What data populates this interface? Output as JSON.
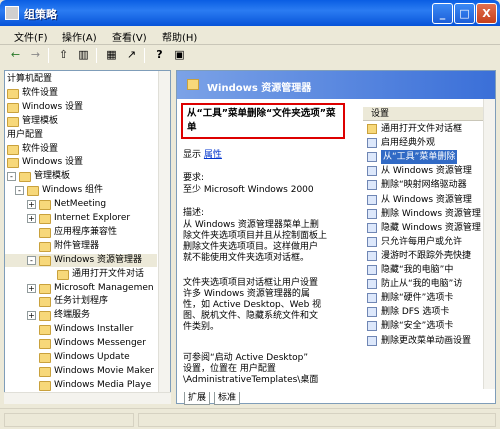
{
  "window": {
    "title": "组策略",
    "min": "_",
    "max": "□",
    "close": "X"
  },
  "menu": [
    "文件(F)",
    "操作(A)",
    "查看(V)",
    "帮助(H)"
  ],
  "toolbar": {
    "back": "←",
    "forward": "→",
    "up": "⇧",
    "showhide": "▥",
    "properties": "▦",
    "export": "↗",
    "help": "?",
    "console": "▣"
  },
  "tree": [
    {
      "label": "计算机配置",
      "level": 0,
      "icon": "none"
    },
    {
      "label": "软件设置",
      "level": 1,
      "icon": "folder"
    },
    {
      "label": "Windows 设置",
      "level": 1,
      "icon": "folder"
    },
    {
      "label": "管理模板",
      "level": 1,
      "icon": "folder"
    },
    {
      "label": "用户配置",
      "level": 0,
      "icon": "none"
    },
    {
      "label": "软件设置",
      "level": 1,
      "icon": "folder"
    },
    {
      "label": "Windows 设置",
      "level": 1,
      "icon": "folder"
    },
    {
      "label": "管理模板",
      "level": 1,
      "icon": "folder",
      "expander": "-"
    },
    {
      "label": "Windows 组件",
      "level": 2,
      "icon": "folder",
      "expander": "-"
    },
    {
      "label": "NetMeeting",
      "level": 3,
      "icon": "folder",
      "expander": "+"
    },
    {
      "label": "Internet Explorer",
      "level": 3,
      "icon": "folder",
      "expander": "+"
    },
    {
      "label": "应用程序兼容性",
      "level": 3,
      "icon": "folder"
    },
    {
      "label": "附件管理器",
      "level": 3,
      "icon": "folder"
    },
    {
      "label": "Windows 资源管理器",
      "level": 3,
      "icon": "folder",
      "expander": "-",
      "selected": true
    },
    {
      "label": "通用打开文件对话",
      "level": 4,
      "icon": "folder"
    },
    {
      "label": "Microsoft Managemen",
      "level": 3,
      "icon": "folder",
      "expander": "+"
    },
    {
      "label": "任务计划程序",
      "level": 3,
      "icon": "folder"
    },
    {
      "label": "终端服务",
      "level": 3,
      "icon": "folder",
      "expander": "+"
    },
    {
      "label": "Windows Installer",
      "level": 3,
      "icon": "folder"
    },
    {
      "label": "Windows Messenger",
      "level": 3,
      "icon": "folder"
    },
    {
      "label": "Windows Update",
      "level": 3,
      "icon": "folder"
    },
    {
      "label": "Windows Movie Maker",
      "level": 3,
      "icon": "folder"
    },
    {
      "label": "Windows Media Playe",
      "level": 3,
      "icon": "folder"
    }
  ],
  "header": {
    "title": "Windows 资源管理器"
  },
  "description": {
    "policy_title": "从“工具”菜单删除“文件夹选项”菜单",
    "show_label": "显示",
    "properties_link": "属性",
    "req_label": "要求:",
    "req_value": "至少 Microsoft Windows 2000",
    "desc_label": "描述:",
    "desc_lines": [
      "从 Windows 资源管理器菜单上删",
      "除文件夹选项项目并且从控制面板上",
      "删除文件夹选项项目。这样做用户",
      "就不能使用文件夹选项对话框。"
    ],
    "desc2_lines": [
      "文件夹选项项目对话框让用户设置",
      "许多 Windows 资源管理器的属",
      "性，如 Active Desktop、Web 视",
      "图、脱机文件、隐藏系统文件和文",
      "件类别。"
    ],
    "desc3_lines": [
      "可参阅“启动 Active Desktop”",
      "设置，位置在 用户配置",
      "\\AdministrativeTemplates\\桌面"
    ]
  },
  "list": {
    "header": "设置",
    "items": [
      "通用打开文件对话框",
      "启用经典外观",
      "从“工具”菜单删除",
      "从 Windows 资源管理",
      "删除“映射网络驱动器",
      "从 Windows 资源管理",
      "删除 Windows 资源管理",
      "隐藏 Windows 资源管理",
      "只允许每用户或允许",
      "漫游时不跟踪外壳快捷",
      "隐藏“我的电脑”中",
      "防止从“我的电脑”访",
      "删除“硬件”选项卡",
      "删除 DFS 选项卡",
      "删除“安全”选项卡",
      "删除更改菜单动画设置"
    ],
    "selected_index": 2
  },
  "tabs": [
    "扩展",
    "标准"
  ],
  "colors": {
    "title": "#0A5EE3",
    "selection": "#316AC5",
    "highlight_border": "#dd0000"
  }
}
